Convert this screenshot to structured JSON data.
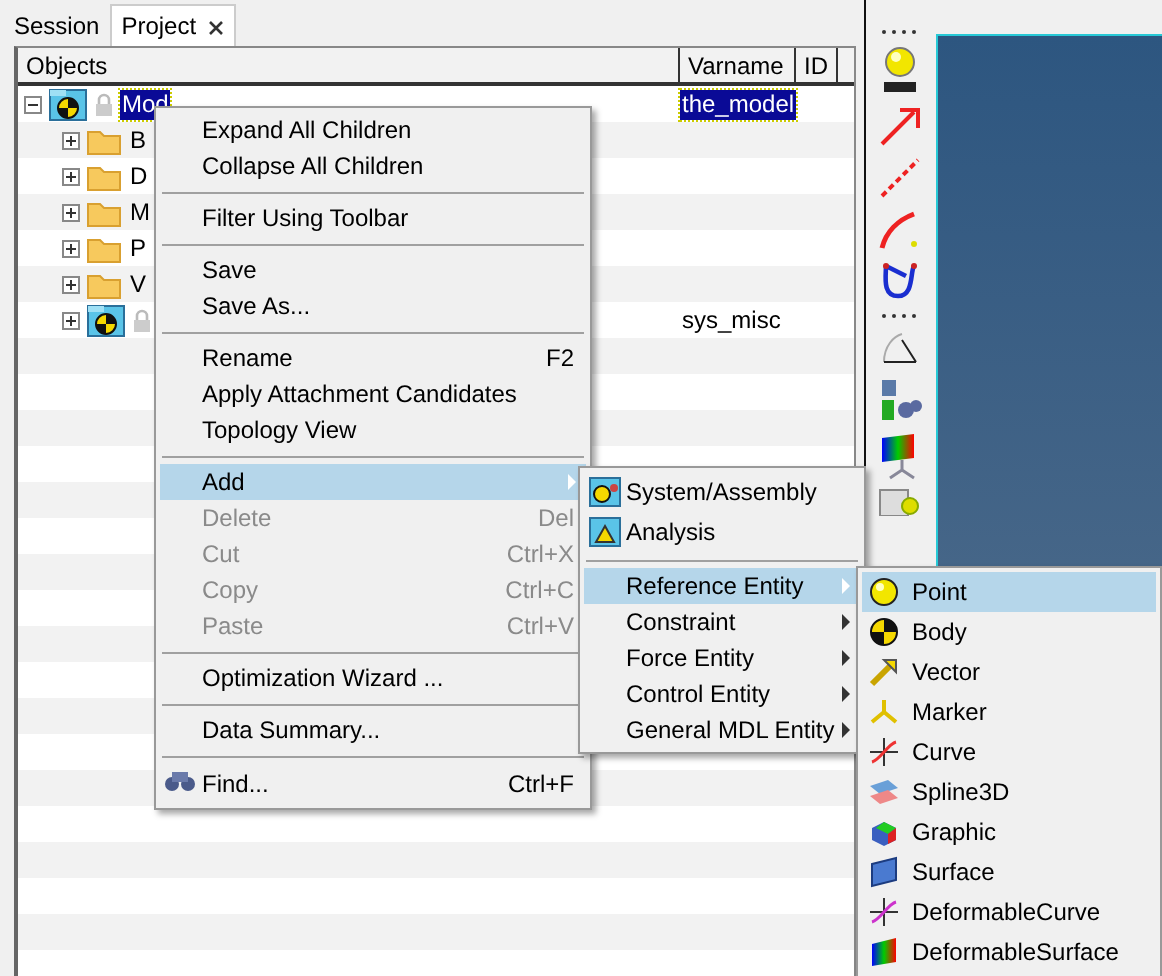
{
  "tabs": [
    {
      "label": "Session",
      "selected": false,
      "closable": false
    },
    {
      "label": "Project",
      "selected": true,
      "closable": true
    }
  ],
  "table": {
    "columns": [
      "Objects",
      "Varname",
      "ID"
    ],
    "tree": [
      {
        "kind": "model",
        "label": "Mod",
        "varname": "the_model",
        "selected": true,
        "expanded": true,
        "children": [
          {
            "kind": "folder",
            "label": "B",
            "expanded": false,
            "selected": false
          },
          {
            "kind": "folder",
            "label": "D",
            "expanded": false,
            "selected": false
          },
          {
            "kind": "folder",
            "label": "M",
            "expanded": false,
            "selected": false
          },
          {
            "kind": "folder",
            "label": "P",
            "expanded": false,
            "selected": false
          },
          {
            "kind": "folder",
            "label": "V",
            "expanded": false,
            "selected": false
          },
          {
            "kind": "model",
            "varname": "sys_misc",
            "expanded": false,
            "selected": false
          }
        ]
      }
    ]
  },
  "context_menu": [
    {
      "kind": "item",
      "label": "Expand All Children",
      "disabled": false,
      "selected": false,
      "submenu": false
    },
    {
      "kind": "item",
      "label": "Collapse All Children",
      "disabled": false,
      "selected": false,
      "submenu": false
    },
    {
      "kind": "separator"
    },
    {
      "kind": "item",
      "label": "Filter Using Toolbar",
      "disabled": false,
      "selected": false,
      "submenu": false
    },
    {
      "kind": "separator"
    },
    {
      "kind": "item",
      "label": "Save",
      "disabled": false,
      "selected": false,
      "submenu": false
    },
    {
      "kind": "item",
      "label": "Save As...",
      "disabled": false,
      "selected": false,
      "submenu": false
    },
    {
      "kind": "separator"
    },
    {
      "kind": "item",
      "label": "Rename",
      "shortcut": "F2",
      "disabled": false,
      "selected": false,
      "submenu": false
    },
    {
      "kind": "item",
      "label": "Apply Attachment Candidates",
      "disabled": false,
      "selected": false,
      "submenu": false
    },
    {
      "kind": "item",
      "label": "Topology View",
      "disabled": false,
      "selected": false,
      "submenu": false
    },
    {
      "kind": "separator"
    },
    {
      "kind": "item",
      "label": "Add",
      "disabled": false,
      "selected": true,
      "submenu": true
    },
    {
      "kind": "item",
      "label": "Delete",
      "shortcut": "Del",
      "disabled": true,
      "selected": false,
      "submenu": false
    },
    {
      "kind": "item",
      "label": "Cut",
      "shortcut": "Ctrl+X",
      "disabled": true,
      "selected": false,
      "submenu": false
    },
    {
      "kind": "item",
      "label": "Copy",
      "shortcut": "Ctrl+C",
      "disabled": true,
      "selected": false,
      "submenu": false
    },
    {
      "kind": "item",
      "label": "Paste",
      "shortcut": "Ctrl+V",
      "disabled": true,
      "selected": false,
      "submenu": false
    },
    {
      "kind": "separator"
    },
    {
      "kind": "item",
      "label": "Optimization Wizard ...",
      "disabled": false,
      "selected": false,
      "submenu": false
    },
    {
      "kind": "separator"
    },
    {
      "kind": "item",
      "label": "Data Summary...",
      "disabled": false,
      "selected": false,
      "submenu": false
    },
    {
      "kind": "separator"
    },
    {
      "kind": "item",
      "label": "Find...",
      "shortcut": "Ctrl+F",
      "icon": true,
      "disabled": false,
      "selected": false,
      "submenu": false
    }
  ],
  "add_menu": [
    {
      "kind": "item",
      "label": "System/Assembly",
      "icon": true,
      "selected": false,
      "submenu": false
    },
    {
      "kind": "item",
      "label": "Analysis",
      "icon": true,
      "selected": false,
      "submenu": false
    },
    {
      "kind": "separator"
    },
    {
      "kind": "item",
      "label": "Reference Entity",
      "selected": true,
      "submenu": true
    },
    {
      "kind": "item",
      "label": "Constraint",
      "selected": false,
      "submenu": true
    },
    {
      "kind": "item",
      "label": "Force Entity",
      "selected": false,
      "submenu": true
    },
    {
      "kind": "item",
      "label": "Control Entity",
      "selected": false,
      "submenu": true
    },
    {
      "kind": "item",
      "label": "General MDL Entity",
      "selected": false,
      "submenu": true
    }
  ],
  "reference_menu": [
    {
      "label": "Point",
      "selected": true
    },
    {
      "label": "Body",
      "selected": false
    },
    {
      "label": "Vector",
      "selected": false
    },
    {
      "label": "Marker",
      "selected": false
    },
    {
      "label": "Curve",
      "selected": false
    },
    {
      "label": "Spline3D",
      "selected": false
    },
    {
      "label": "Graphic",
      "selected": false
    },
    {
      "label": "Surface",
      "selected": false
    },
    {
      "label": "DeformableCurve",
      "selected": false
    },
    {
      "label": "DeformableSurface",
      "selected": false
    }
  ]
}
